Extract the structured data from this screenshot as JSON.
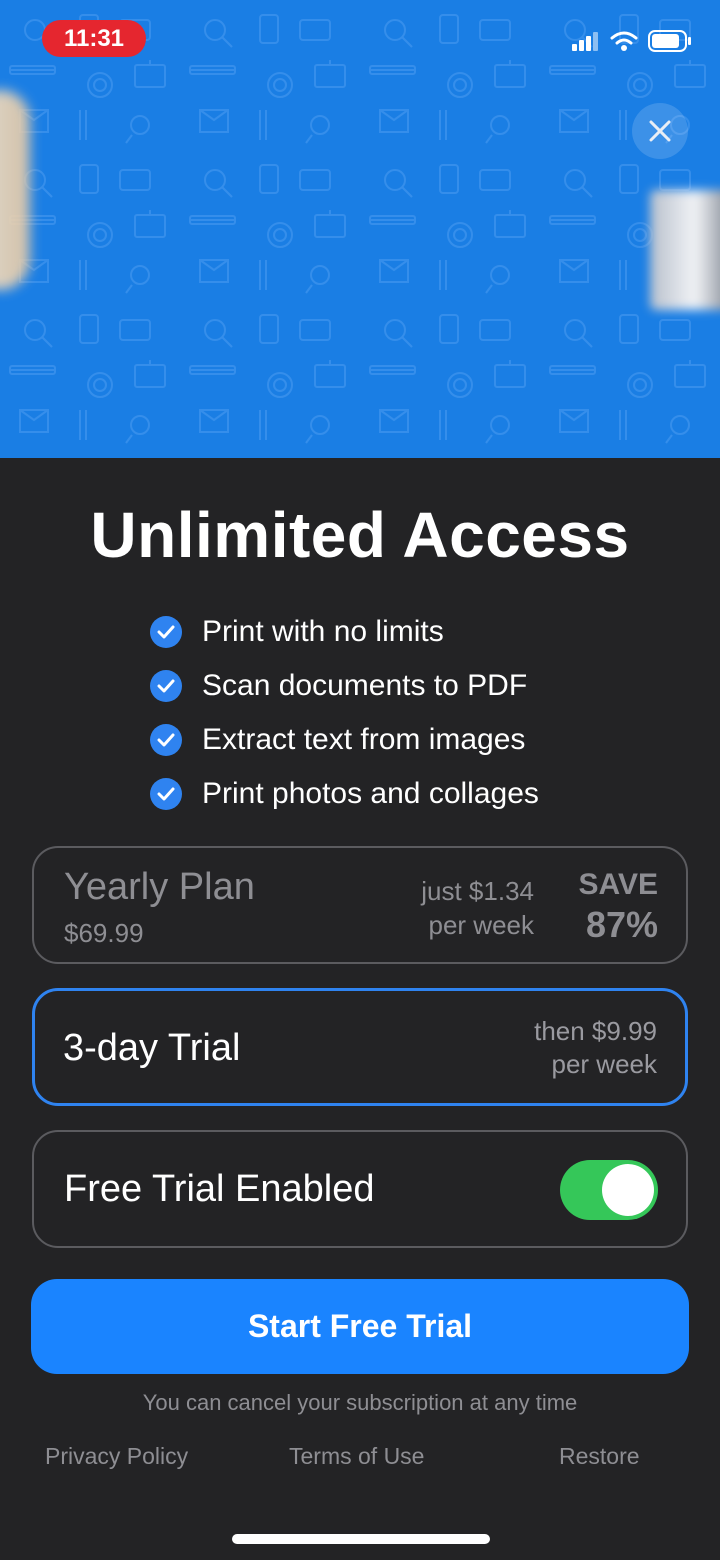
{
  "status_bar": {
    "time": "11:31"
  },
  "header": {
    "close_icon": "close-icon"
  },
  "title": "Unlimited Access",
  "features": [
    "Print with no limits",
    "Scan documents to PDF",
    "Extract text from images",
    "Print photos and collages"
  ],
  "plans": {
    "yearly": {
      "name": "Yearly Plan",
      "price": "$69.99",
      "per_week_line1": "just $1.34",
      "per_week_line2": "per week",
      "save_line1": "SAVE",
      "save_line2": "87%"
    },
    "trial": {
      "name": "3-day Trial",
      "then_line1": "then $9.99",
      "then_line2": "per week"
    }
  },
  "free_trial_toggle": {
    "label": "Free Trial Enabled",
    "enabled": true
  },
  "cta": {
    "label": "Start Free Trial"
  },
  "cancel_note": "You can cancel your subscription at any time",
  "footer": {
    "privacy": "Privacy Policy",
    "terms": "Terms of Use",
    "restore": "Restore"
  },
  "colors": {
    "hero_blue": "#1a7ee4",
    "accent_blue": "#1a84ff",
    "toggle_green": "#35c759",
    "status_red": "#e5262f",
    "background": "#232325"
  }
}
